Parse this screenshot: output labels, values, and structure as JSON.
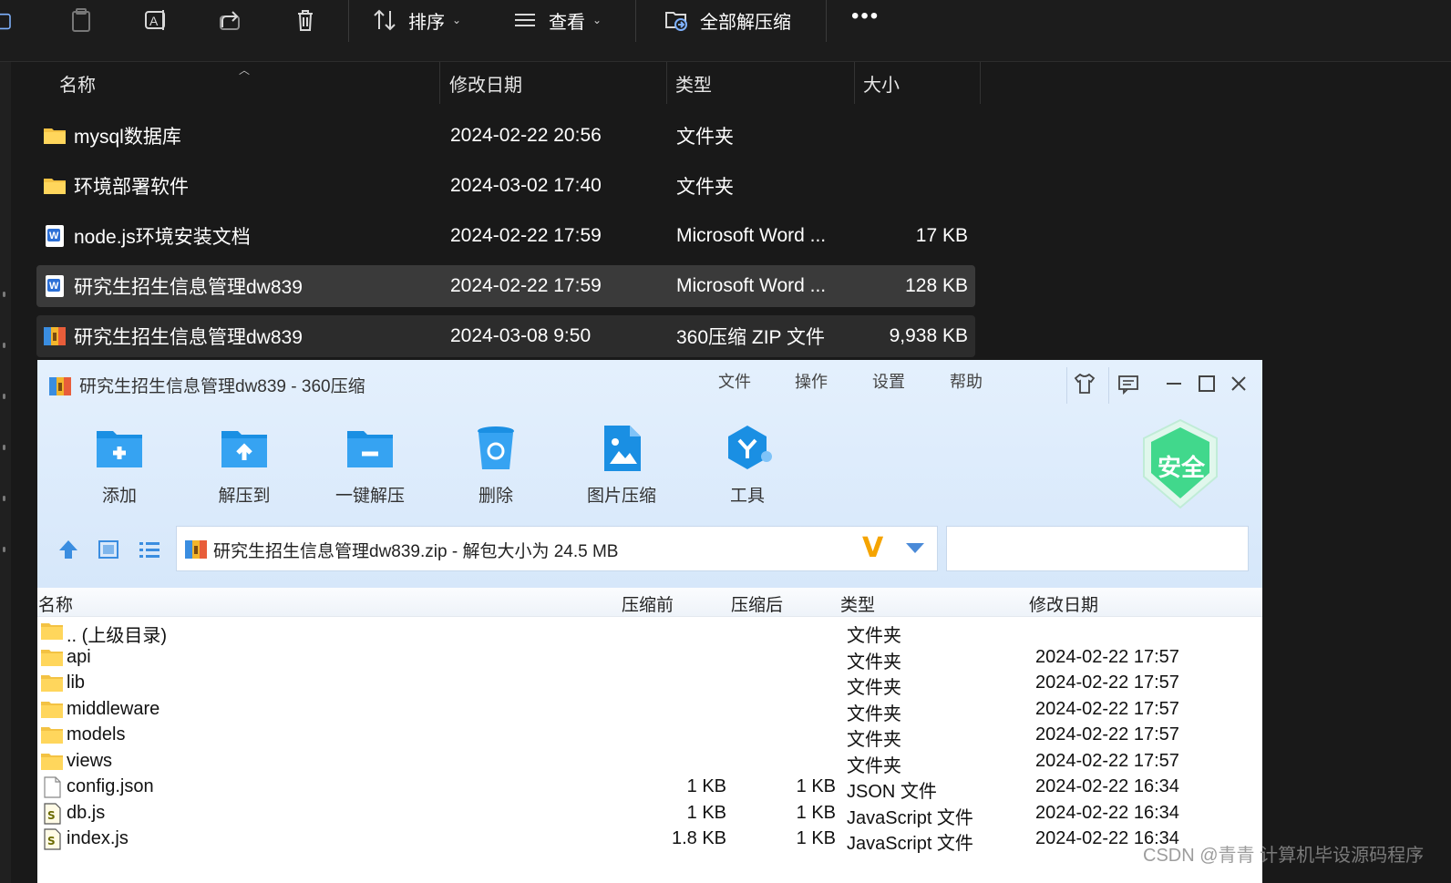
{
  "explorer": {
    "toolbar": {
      "sort_label": "排序",
      "view_label": "查看",
      "extract_all_label": "全部解压缩",
      "more_label": "•••"
    },
    "columns": {
      "name": "名称",
      "modified": "修改日期",
      "type": "类型",
      "size": "大小"
    },
    "rows": [
      {
        "name": "mysql数据库",
        "modified": "2024-02-22 20:56",
        "type": "文件夹",
        "size": "",
        "icon": "folder-icon"
      },
      {
        "name": "环境部署软件",
        "modified": "2024-03-02 17:40",
        "type": "文件夹",
        "size": "",
        "icon": "folder-icon"
      },
      {
        "name": "node.js环境安装文档",
        "modified": "2024-02-22 17:59",
        "type": "Microsoft Word ...",
        "size": "17 KB",
        "icon": "word-doc-icon"
      },
      {
        "name": "研究生招生信息管理dw839",
        "modified": "2024-02-22 17:59",
        "type": "Microsoft Word ...",
        "size": "128 KB",
        "icon": "word-doc-icon"
      },
      {
        "name": "研究生招生信息管理dw839",
        "modified": "2024-03-08 9:50",
        "type": "360压缩 ZIP 文件",
        "size": "9,938 KB",
        "icon": "zip-archive-icon"
      }
    ]
  },
  "zip_window": {
    "title": "研究生招生信息管理dw839 - 360压缩",
    "menu": {
      "file": "文件",
      "operate": "操作",
      "settings": "设置",
      "help": "帮助"
    },
    "tools": {
      "add": "添加",
      "extract_to": "解压到",
      "one_click": "一键解压",
      "delete": "删除",
      "image_compress": "图片压缩",
      "tools": "工具"
    },
    "shield_label": "安全",
    "path_text": "研究生招生信息管理dw839.zip - 解包大小为 24.5 MB",
    "path_badge": "V",
    "search": {
      "value": ""
    },
    "columns": {
      "name": "名称",
      "before": "压缩前",
      "after": "压缩后",
      "type": "类型",
      "modified": "修改日期"
    },
    "rows": [
      {
        "name": ".. (上级目录)",
        "before": "",
        "after": "",
        "type": "文件夹",
        "modified": "",
        "icon": "folder-icon"
      },
      {
        "name": "api",
        "before": "",
        "after": "",
        "type": "文件夹",
        "modified": "2024-02-22 17:57",
        "icon": "folder-icon"
      },
      {
        "name": "lib",
        "before": "",
        "after": "",
        "type": "文件夹",
        "modified": "2024-02-22 17:57",
        "icon": "folder-icon"
      },
      {
        "name": "middleware",
        "before": "",
        "after": "",
        "type": "文件夹",
        "modified": "2024-02-22 17:57",
        "icon": "folder-icon"
      },
      {
        "name": "models",
        "before": "",
        "after": "",
        "type": "文件夹",
        "modified": "2024-02-22 17:57",
        "icon": "folder-icon"
      },
      {
        "name": "views",
        "before": "",
        "after": "",
        "type": "文件夹",
        "modified": "2024-02-22 17:57",
        "icon": "folder-icon"
      },
      {
        "name": "config.json",
        "before": "1 KB",
        "after": "1 KB",
        "type": "JSON 文件",
        "modified": "2024-02-22 16:34",
        "icon": "blank-file-icon"
      },
      {
        "name": "db.js",
        "before": "1 KB",
        "after": "1 KB",
        "type": "JavaScript 文件",
        "modified": "2024-02-22 16:34",
        "icon": "script-file-icon"
      },
      {
        "name": "index.js",
        "before": "1.8 KB",
        "after": "1 KB",
        "type": "JavaScript 文件",
        "modified": "2024-02-22 16:34",
        "icon": "script-file-icon"
      }
    ]
  },
  "watermark": "CSDN @青青  计算机毕设源码程序",
  "colors": {
    "explorer_bg": "#191919",
    "selected_row": "#3a3a3a",
    "zip_header_bg": "#d6e7fa",
    "accent_blue": "#1a8fe3",
    "shield_green": "#41d88c"
  }
}
